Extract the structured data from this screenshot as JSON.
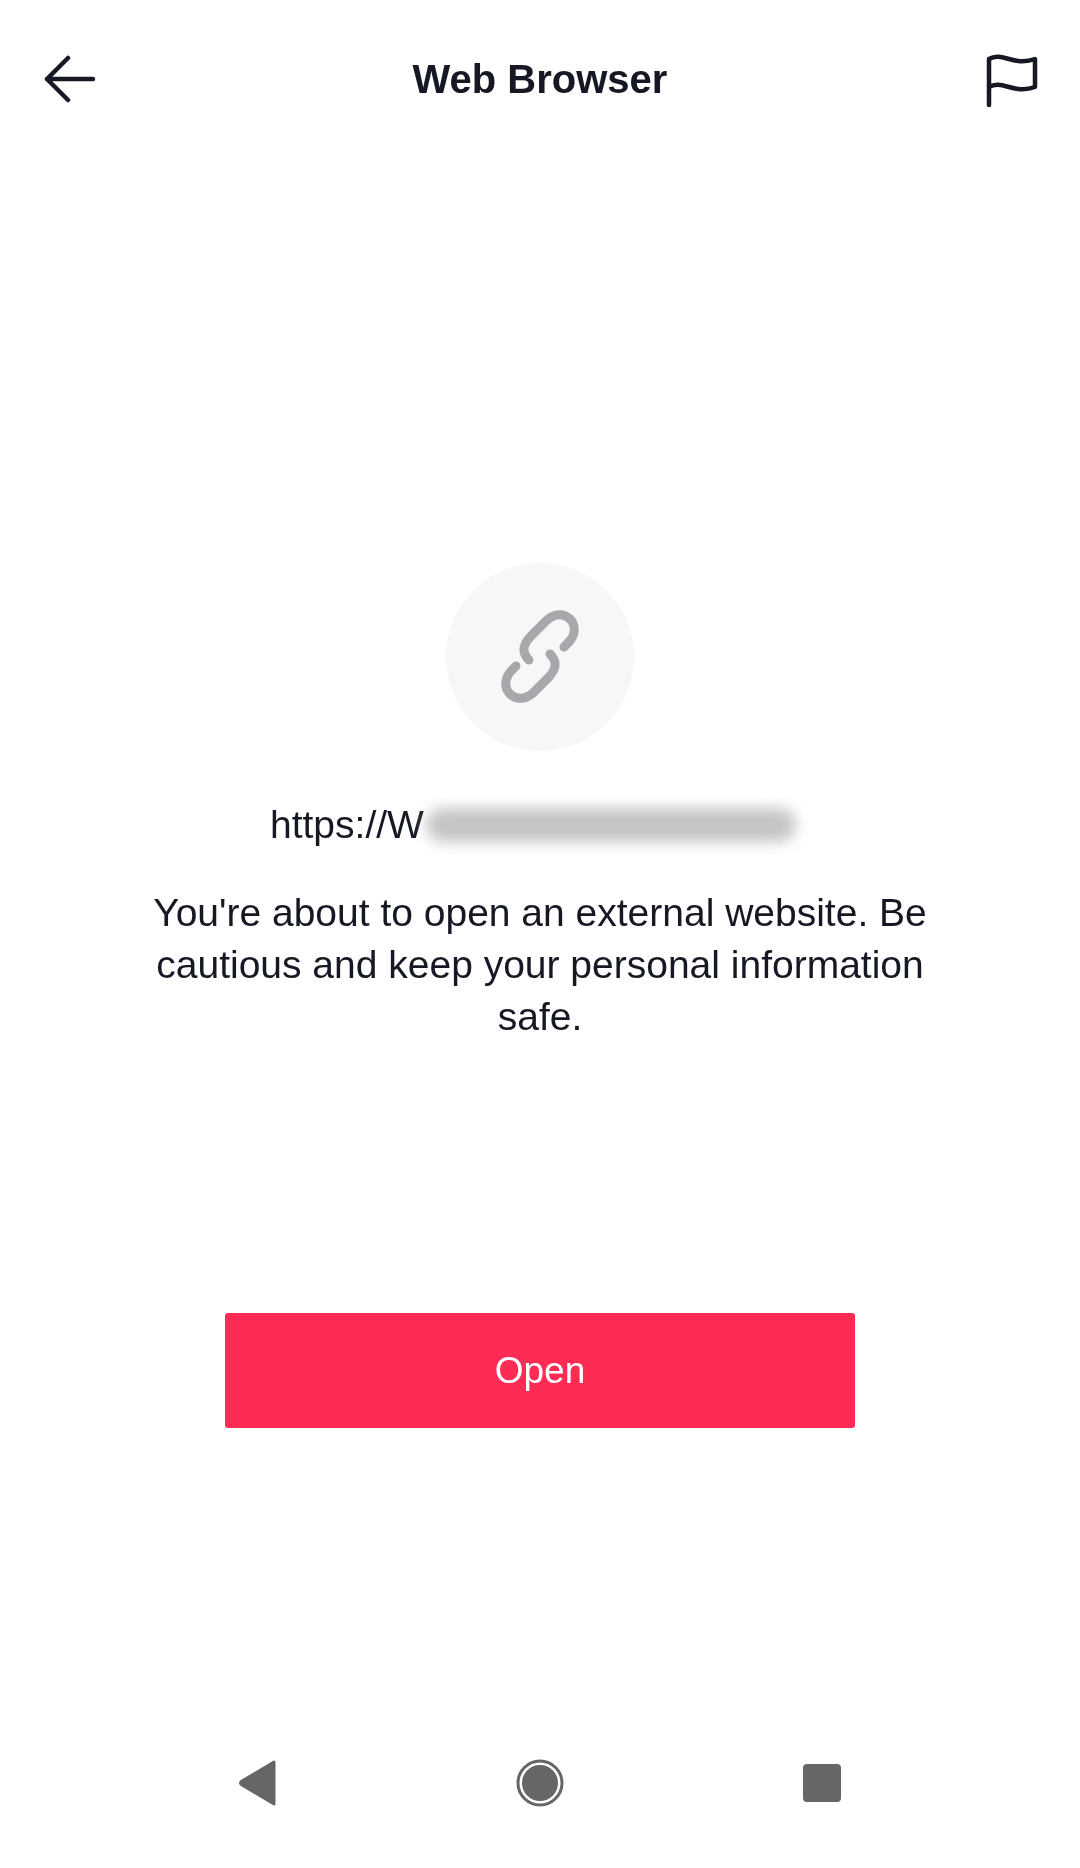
{
  "header": {
    "title": "Web Browser"
  },
  "link": {
    "url": "https://W"
  },
  "message": "You're about to open an external website. Be cautious and keep your personal information safe.",
  "buttons": [
    "Open"
  ]
}
